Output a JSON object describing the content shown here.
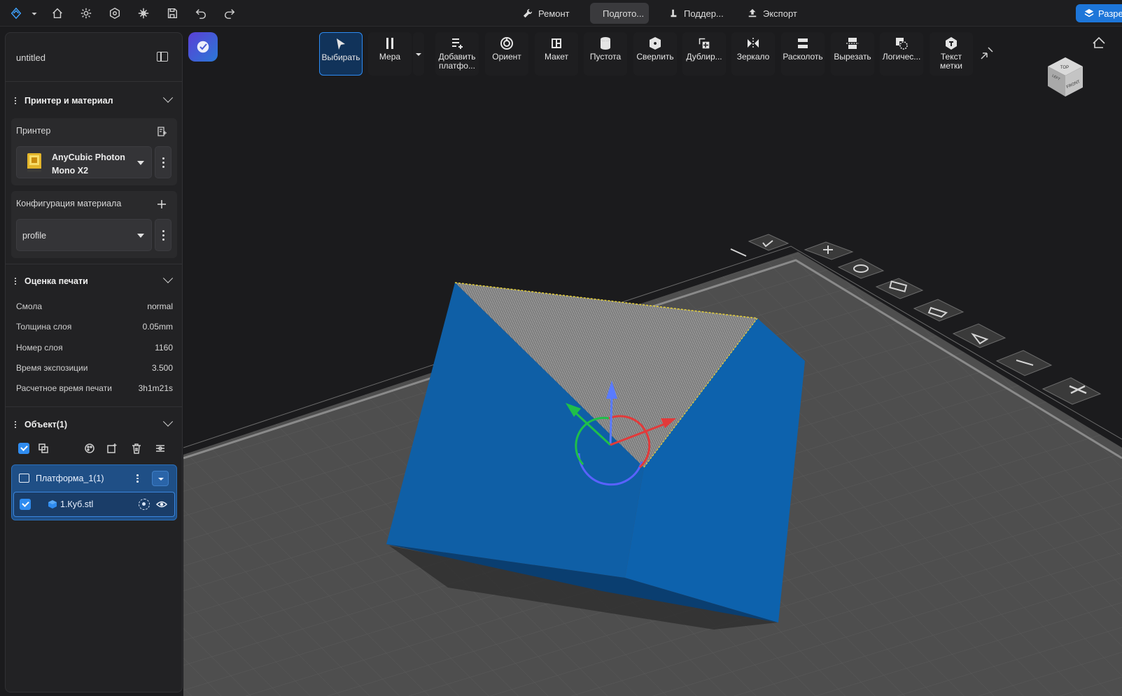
{
  "topbar": {
    "modes": [
      {
        "label": "Ремонт",
        "active": false
      },
      {
        "label": "Подгото...",
        "active": true
      },
      {
        "label": "Поддер...",
        "active": false
      },
      {
        "label": "Экспорт",
        "active": false
      }
    ],
    "upgrade_label": "Разре"
  },
  "project": {
    "name": "untitled"
  },
  "sections": {
    "printer_material": "Принтер и материал",
    "print_estimate": "Оценка печати",
    "objects": "Объект(1)"
  },
  "printer": {
    "label": "Принтер",
    "model_line1": "AnyCubic Photon",
    "model_line2": "Mono X2"
  },
  "material": {
    "label": "Конфигурация материала",
    "profile": "profile"
  },
  "estimate": {
    "rows": [
      {
        "key": "Смола",
        "value": "normal"
      },
      {
        "key": "Толщина слоя",
        "value": "0.05mm"
      },
      {
        "key": "Номер слоя",
        "value": "1160"
      },
      {
        "key": "Время экспозиции",
        "value": "3.500"
      },
      {
        "key": "Расчетное время печати",
        "value": "3h1m21s"
      }
    ]
  },
  "objects": {
    "platform": "Платформа_1(1)",
    "items": [
      {
        "name": "1.Куб.stl",
        "checked": true,
        "visible": true
      }
    ]
  },
  "toolbar": {
    "tools": [
      {
        "label": "Выбирать",
        "icon": "cursor-icon",
        "active": true
      },
      {
        "label": "Мера",
        "icon": "ruler-icon",
        "active": false
      },
      {
        "label": "Добавить\nплатфо...",
        "icon": "add-platform-icon",
        "active": false
      },
      {
        "label": "Ориент",
        "icon": "orient-icon",
        "active": false
      },
      {
        "label": "Макет",
        "icon": "layout-icon",
        "active": false
      },
      {
        "label": "Пустота",
        "icon": "hollow-icon",
        "active": false
      },
      {
        "label": "Сверлить",
        "icon": "drill-icon",
        "active": false
      },
      {
        "label": "Дублир...",
        "icon": "duplicate-icon",
        "active": false
      },
      {
        "label": "Зеркало",
        "icon": "mirror-icon",
        "active": false
      },
      {
        "label": "Расколоть",
        "icon": "split-icon",
        "active": false
      },
      {
        "label": "Вырезать",
        "icon": "cut-icon",
        "active": false
      },
      {
        "label": "Логичес...",
        "icon": "boolean-icon",
        "active": false
      },
      {
        "label": "Текст\nметки",
        "icon": "text-label-icon",
        "active": false
      }
    ]
  },
  "viewcube": {
    "top": "TOP",
    "front": "FRONT",
    "left": "LEFT"
  },
  "colors": {
    "accent": "#2d8bf2",
    "model": "#0f5fa6",
    "background": "#1b1b1d"
  }
}
